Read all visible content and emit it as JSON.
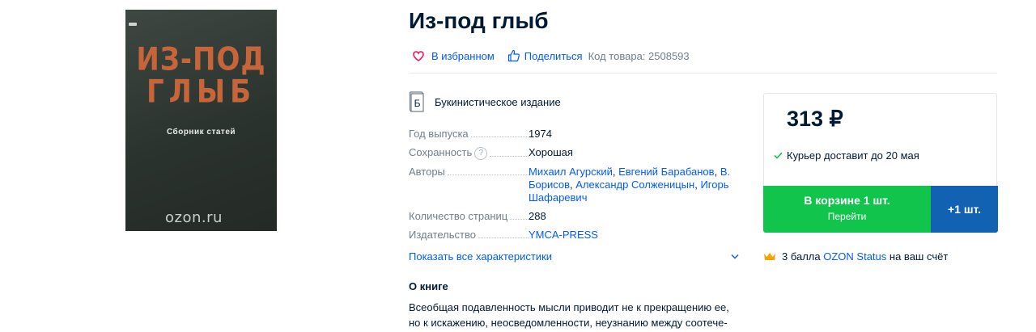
{
  "cover": {
    "title_line1": "ИЗ-ПОД",
    "title_line2": "ГЛЫБ",
    "subtitle": "Сборник статей",
    "brand": "ozon.ru",
    "colors": {
      "background": "#2f3732",
      "title": "#c7653a"
    }
  },
  "product": {
    "title": "Из-под глыб",
    "favorite_label": "В избранном",
    "share_label": "Поделиться",
    "sku_text": "Код товара: 2508593",
    "used_icon_letter": "Б",
    "used_label": "Букинистическое издание"
  },
  "specs": [
    {
      "key": "Год выпуска",
      "value": "1974"
    },
    {
      "key": "Сохранность",
      "value": "Хорошая",
      "help": "?"
    },
    {
      "key": "Авторы",
      "authors": [
        "Михаил Агурский",
        "Евгений Барабанов",
        "В. Борисов",
        "Александр Солженицын",
        "Игорь Шафаревич"
      ]
    },
    {
      "key": "Количество страниц",
      "value": "288"
    },
    {
      "key": "Издательство",
      "link": "YMCA-PRESS"
    }
  ],
  "show_all_label": "Показать все характеристики",
  "about": {
    "heading": "О книге",
    "text": "Всеобщая подавленность мысли приводит не к прекращению ее, но к искажению, неосведомленности, неузнанию между соотече-"
  },
  "buybox": {
    "price": "313 ₽",
    "delivery": "Курьер доставит до 20 мая",
    "cart_line1": "В корзине 1 шт.",
    "cart_line2": "Перейти",
    "plus_label": "+1 шт.",
    "colors": {
      "cart": "#10c44c",
      "plus": "#1262b3",
      "check": "#10c44c"
    }
  },
  "points": {
    "prefix": "3 балла",
    "link": "OZON Status",
    "suffix": "на ваш счёт"
  }
}
